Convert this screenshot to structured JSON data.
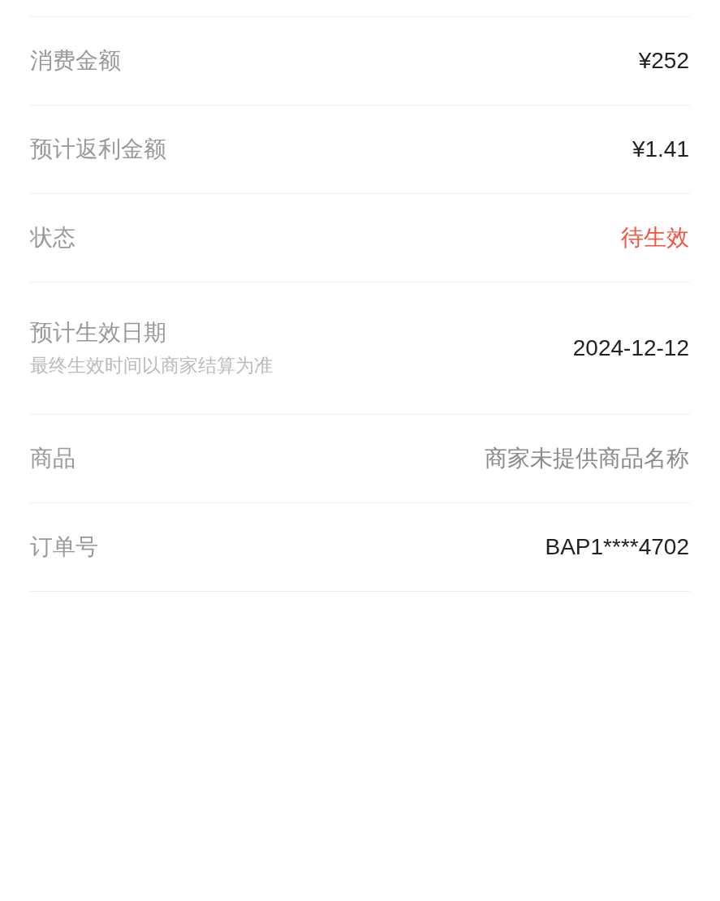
{
  "rows": [
    {
      "label": "消费金额",
      "value": "¥252",
      "kind": "plain"
    },
    {
      "label": "预计返利金额",
      "value": "¥1.41",
      "kind": "plain"
    },
    {
      "label": "状态",
      "value": "待生效",
      "kind": "status"
    },
    {
      "label": "预计生效日期",
      "note": "最终生效时间以商家结算为准",
      "value": "2024-12-12",
      "kind": "plain"
    },
    {
      "label": "商品",
      "value": "商家未提供商品名称",
      "kind": "muted"
    },
    {
      "label": "订单号",
      "value": "BAP1****4702",
      "kind": "plain"
    }
  ]
}
